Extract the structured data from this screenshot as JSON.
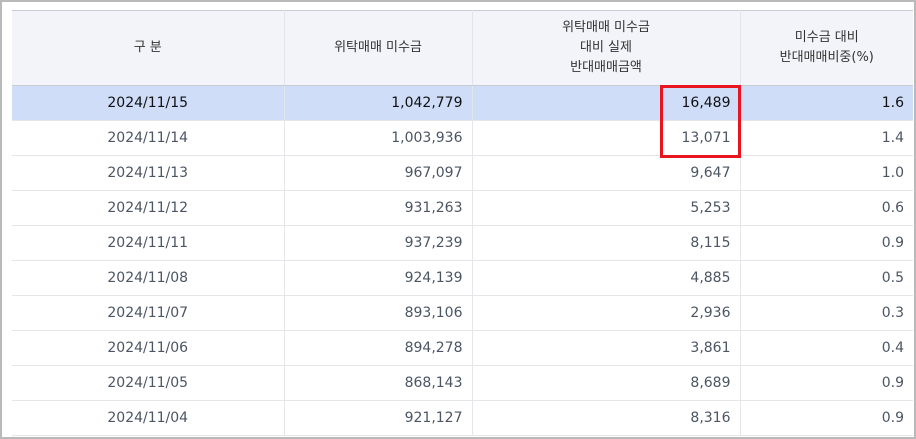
{
  "table": {
    "headers": [
      [
        "구 분"
      ],
      [
        "위탁매매 미수금"
      ],
      [
        "위탁매매 미수금",
        "대비 실제",
        "반대매매금액"
      ],
      [
        "미수금 대비",
        "반대매매비중(%)"
      ]
    ],
    "rows": [
      {
        "date": "2024/11/15",
        "receivable": "1,042,779",
        "actual": "16,489",
        "ratio": "1.6"
      },
      {
        "date": "2024/11/14",
        "receivable": "1,003,936",
        "actual": "13,071",
        "ratio": "1.4"
      },
      {
        "date": "2024/11/13",
        "receivable": "967,097",
        "actual": "9,647",
        "ratio": "1.0"
      },
      {
        "date": "2024/11/12",
        "receivable": "931,263",
        "actual": "5,253",
        "ratio": "0.6"
      },
      {
        "date": "2024/11/11",
        "receivable": "937,239",
        "actual": "8,115",
        "ratio": "0.9"
      },
      {
        "date": "2024/11/08",
        "receivable": "924,139",
        "actual": "4,885",
        "ratio": "0.5"
      },
      {
        "date": "2024/11/07",
        "receivable": "893,106",
        "actual": "2,936",
        "ratio": "0.3"
      },
      {
        "date": "2024/11/06",
        "receivable": "894,278",
        "actual": "3,861",
        "ratio": "0.4"
      },
      {
        "date": "2024/11/05",
        "receivable": "868,143",
        "actual": "8,689",
        "ratio": "0.9"
      },
      {
        "date": "2024/11/04",
        "receivable": "921,127",
        "actual": "8,316",
        "ratio": "0.9"
      }
    ],
    "highlighted_row": 0
  },
  "colors": {
    "header_bg": "#f2f4f9",
    "highlight_bg": "#cfddf9",
    "annotation_box": "#e8141f"
  }
}
